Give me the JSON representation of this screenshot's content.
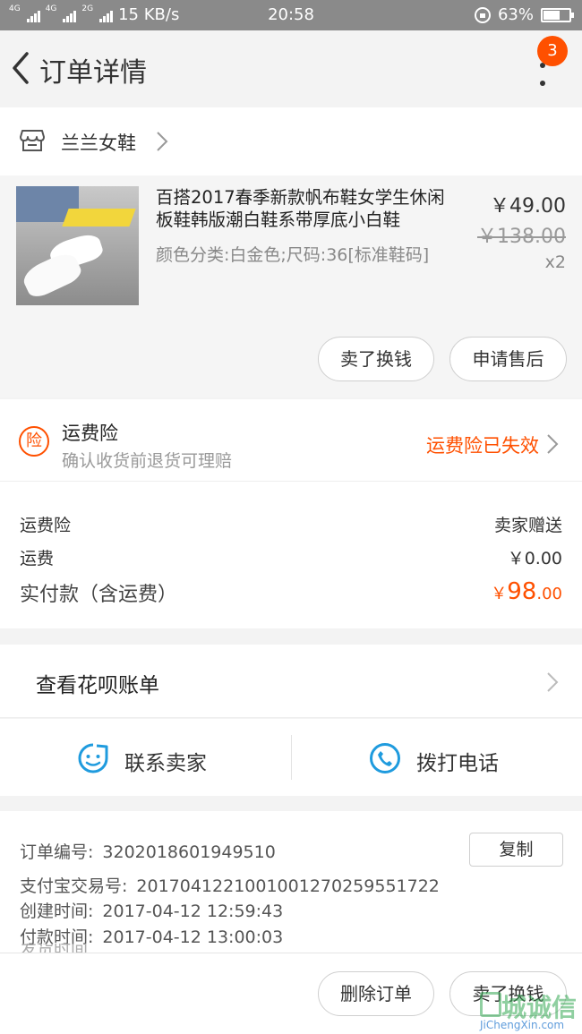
{
  "status_bar": {
    "network1": "4G",
    "network2": "4G",
    "network3": "2G",
    "speed": "15 KB/s",
    "time": "20:58",
    "battery": "63%",
    "battery_level": 0.63
  },
  "header": {
    "title": "订单详情",
    "badge_count": "3"
  },
  "shop": {
    "name": "兰兰女鞋"
  },
  "product": {
    "title": "百搭2017春季新款帆布鞋女学生休闲板鞋韩版潮白鞋系带厚底小白鞋",
    "sku": "颜色分类:白金色;尺码:36[标准鞋码]",
    "price": "￥49.00",
    "original_price": "￥138.00",
    "quantity": "x2",
    "sell_button": "卖了换钱",
    "after_sale_button": "申请售后"
  },
  "insurance": {
    "icon_char": "险",
    "title": "运费险",
    "subtitle": "确认收货前退货可理赔",
    "status": "运费险已失效"
  },
  "fees": {
    "insurance_label": "运费险",
    "insurance_value": "卖家赠送",
    "shipping_label": "运费",
    "shipping_value": "￥0.00",
    "paid_label": "实付款（含运费）",
    "paid_currency": "￥",
    "paid_integer": "98",
    "paid_decimal": ".00"
  },
  "huabei": {
    "label": "查看花呗账单"
  },
  "contact": {
    "seller_label": "联系卖家",
    "call_label": "拨打电话"
  },
  "order_info": {
    "order_no_label": "订单编号:",
    "order_no": "3202018601949510",
    "copy_button": "复制",
    "alipay_label": "支付宝交易号:",
    "alipay_no": "2017041221001001270259551722",
    "created_label": "创建时间:",
    "created_time": "2017-04-12 12:59:43",
    "paid_label": "付款时间:",
    "paid_time": "2017-04-12 13:00:03",
    "shipped_label": "发货时间"
  },
  "bottom_bar": {
    "delete_button": "删除订单",
    "sell_button": "卖了换钱"
  },
  "watermark": {
    "text": "城诚信",
    "url": "JiChengXin.com"
  },
  "colors": {
    "accent": "#ff5000",
    "contact_blue": "#1f9bde"
  }
}
